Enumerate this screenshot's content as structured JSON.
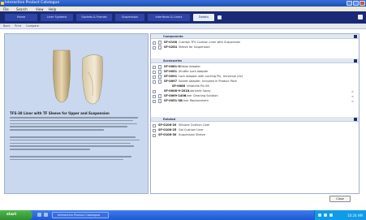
{
  "window": {
    "title": "Interactive Product Catalogue"
  },
  "menu": [
    "File",
    "Search",
    "View",
    "Help"
  ],
  "tabs": [
    {
      "label": "Home",
      "active": false
    },
    {
      "label": "Liner Systems",
      "active": false
    },
    {
      "label": "Sockets & Frames",
      "active": false
    },
    {
      "label": "Suspension",
      "active": false
    },
    {
      "label": "Interfaces & Liners",
      "active": false
    },
    {
      "label": "Details",
      "active": true
    }
  ],
  "subtoolbar": [
    "Back",
    "Print",
    "Compare"
  ],
  "left": {
    "heading": "TFS-38 Liner with TF Sleeve for Upper and Suspension",
    "image_icon": "prosthetic-liner-image"
  },
  "right": {
    "sections": [
      {
        "label": "Components",
        "rows": [
          {
            "code": "SF-0198",
            "desc": "Cushion TFS Cushion Liner with Suspension",
            "arrow": ""
          },
          {
            "code": "SF-0254",
            "desc": "Sleeve for Suspension",
            "arrow": ""
          }
        ]
      },
      {
        "label": "Accessories",
        "rows": [
          {
            "code": "SF-0081-0",
            "desc": "Distal Adapter",
            "arrow": ""
          },
          {
            "code": "SF-0051",
            "desc": "Shuttle Lock Adapter",
            "arrow": ""
          },
          {
            "code": "SF-0091",
            "desc": "Lock Adapter with Locking Pin, Universal (4x)",
            "arrow": ""
          },
          {
            "code": "SF-0097",
            "desc": "Socket Adapter, Included in Product Pack",
            "arrow": ""
          },
          {
            "code": "SF-0088",
            "desc": "Umbrella Pin Kit",
            "arrow": ""
          },
          {
            "code": "SF-0008-9-2010",
            "desc": "Lubricant Spray",
            "arrow": ">"
          },
          {
            "code": "SF-0069-1406",
            "desc": "Liner Cleaning Solution",
            "arrow": ">"
          },
          {
            "code": "SF-0051-36",
            "desc": "Liner Replacement",
            "arrow": ">"
          }
        ]
      },
      {
        "label": "Related",
        "rows": [
          {
            "code": "SF-0108-20",
            "desc": "Silicone Cushion Liner",
            "arrow": ""
          },
          {
            "code": "SF-0108-25",
            "desc": "Gel Cushion Liner",
            "arrow": ""
          },
          {
            "code": "SF-0108-30",
            "desc": "Suspension Sleeve",
            "arrow": ""
          }
        ]
      }
    ]
  },
  "footer": {
    "done_label": "Close"
  },
  "taskbar": {
    "start_label": "start",
    "tasks": [
      "Interactive Product Catalogue"
    ],
    "clock": "10:24 AM"
  },
  "colors": {
    "tabstrip": "#1a2a78",
    "left_pane": "#c9d8ee",
    "taskbar": "#1f57d0",
    "start": "#2f8e2f"
  }
}
